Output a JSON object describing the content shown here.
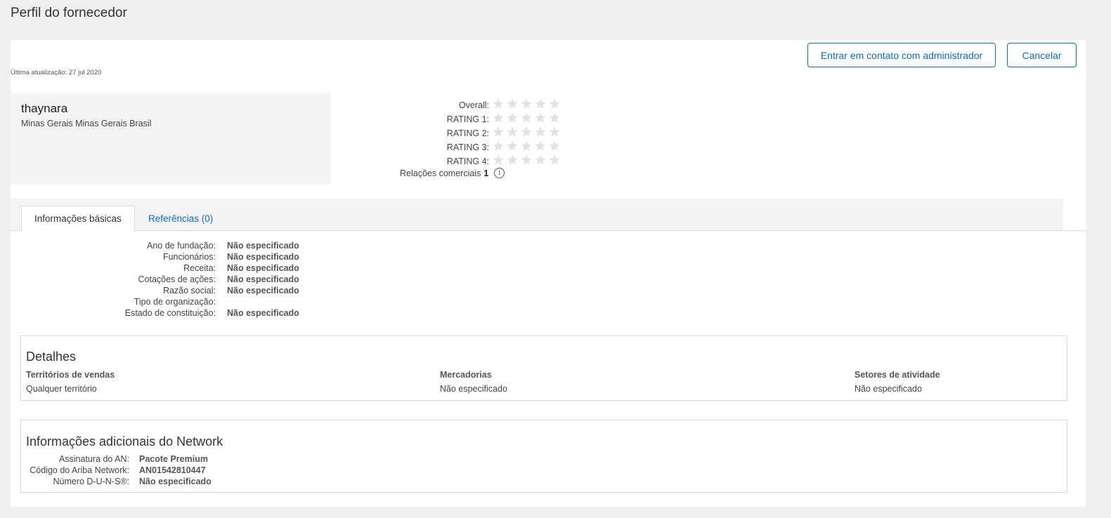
{
  "header": {
    "title": "Perfil do fornecedor"
  },
  "meta": {
    "last_updated": "Última atualização: 27 jul 2020"
  },
  "actions": {
    "contact_admin": "Entrar em contato com administrador",
    "cancel": "Cancelar"
  },
  "supplier": {
    "name": "thaynara",
    "location": "Minas Gerais Minas Gerais Brasil"
  },
  "ratings": {
    "rows": [
      {
        "label": "Overall:",
        "stars": 0,
        "max": 5
      },
      {
        "label": "RATING 1:",
        "stars": 0,
        "max": 5
      },
      {
        "label": "RATING 2:",
        "stars": 0,
        "max": 5
      },
      {
        "label": "RATING 3:",
        "stars": 0,
        "max": 5
      },
      {
        "label": "RATING 4:",
        "stars": 0,
        "max": 5
      }
    ],
    "relations_label": "Relações comerciais",
    "relations_count": "1",
    "info_glyph": "i"
  },
  "tabs": [
    {
      "label": "Informações básicas",
      "active": true
    },
    {
      "label": "Referências (0)",
      "active": false
    }
  ],
  "basic_info": [
    {
      "key": "Ano de fundação:",
      "value": "Não especificado"
    },
    {
      "key": "Funcionários:",
      "value": "Não especificado"
    },
    {
      "key": "Receita:",
      "value": "Não especificado"
    },
    {
      "key": "Cotações de ações:",
      "value": "Não especificado"
    },
    {
      "key": "Razão social:",
      "value": "Não especificado"
    },
    {
      "key": "Tipo de organização:",
      "value": ""
    },
    {
      "key": "Estado de constituição:",
      "value": "Não especificado"
    }
  ],
  "details": {
    "title": "Detalhes",
    "columns": [
      {
        "header": "Territórios de vendas",
        "value": "Qualquer território"
      },
      {
        "header": "Mercadorias",
        "value": "Não especificado"
      },
      {
        "header": "Setores de atividade",
        "value": "Não especificado"
      }
    ]
  },
  "network": {
    "title": "Informações adicionais do Network",
    "rows": [
      {
        "key": "Assinatura do AN:",
        "value": "Pacote Premium"
      },
      {
        "key": "Código do Ariba Network:",
        "value": "AN01542810447"
      },
      {
        "key": "Número D-U-N-S®:",
        "value": "Não especificado"
      }
    ]
  },
  "colors": {
    "accent": "#0a6ed1",
    "star_empty": "#e2e2e2"
  }
}
